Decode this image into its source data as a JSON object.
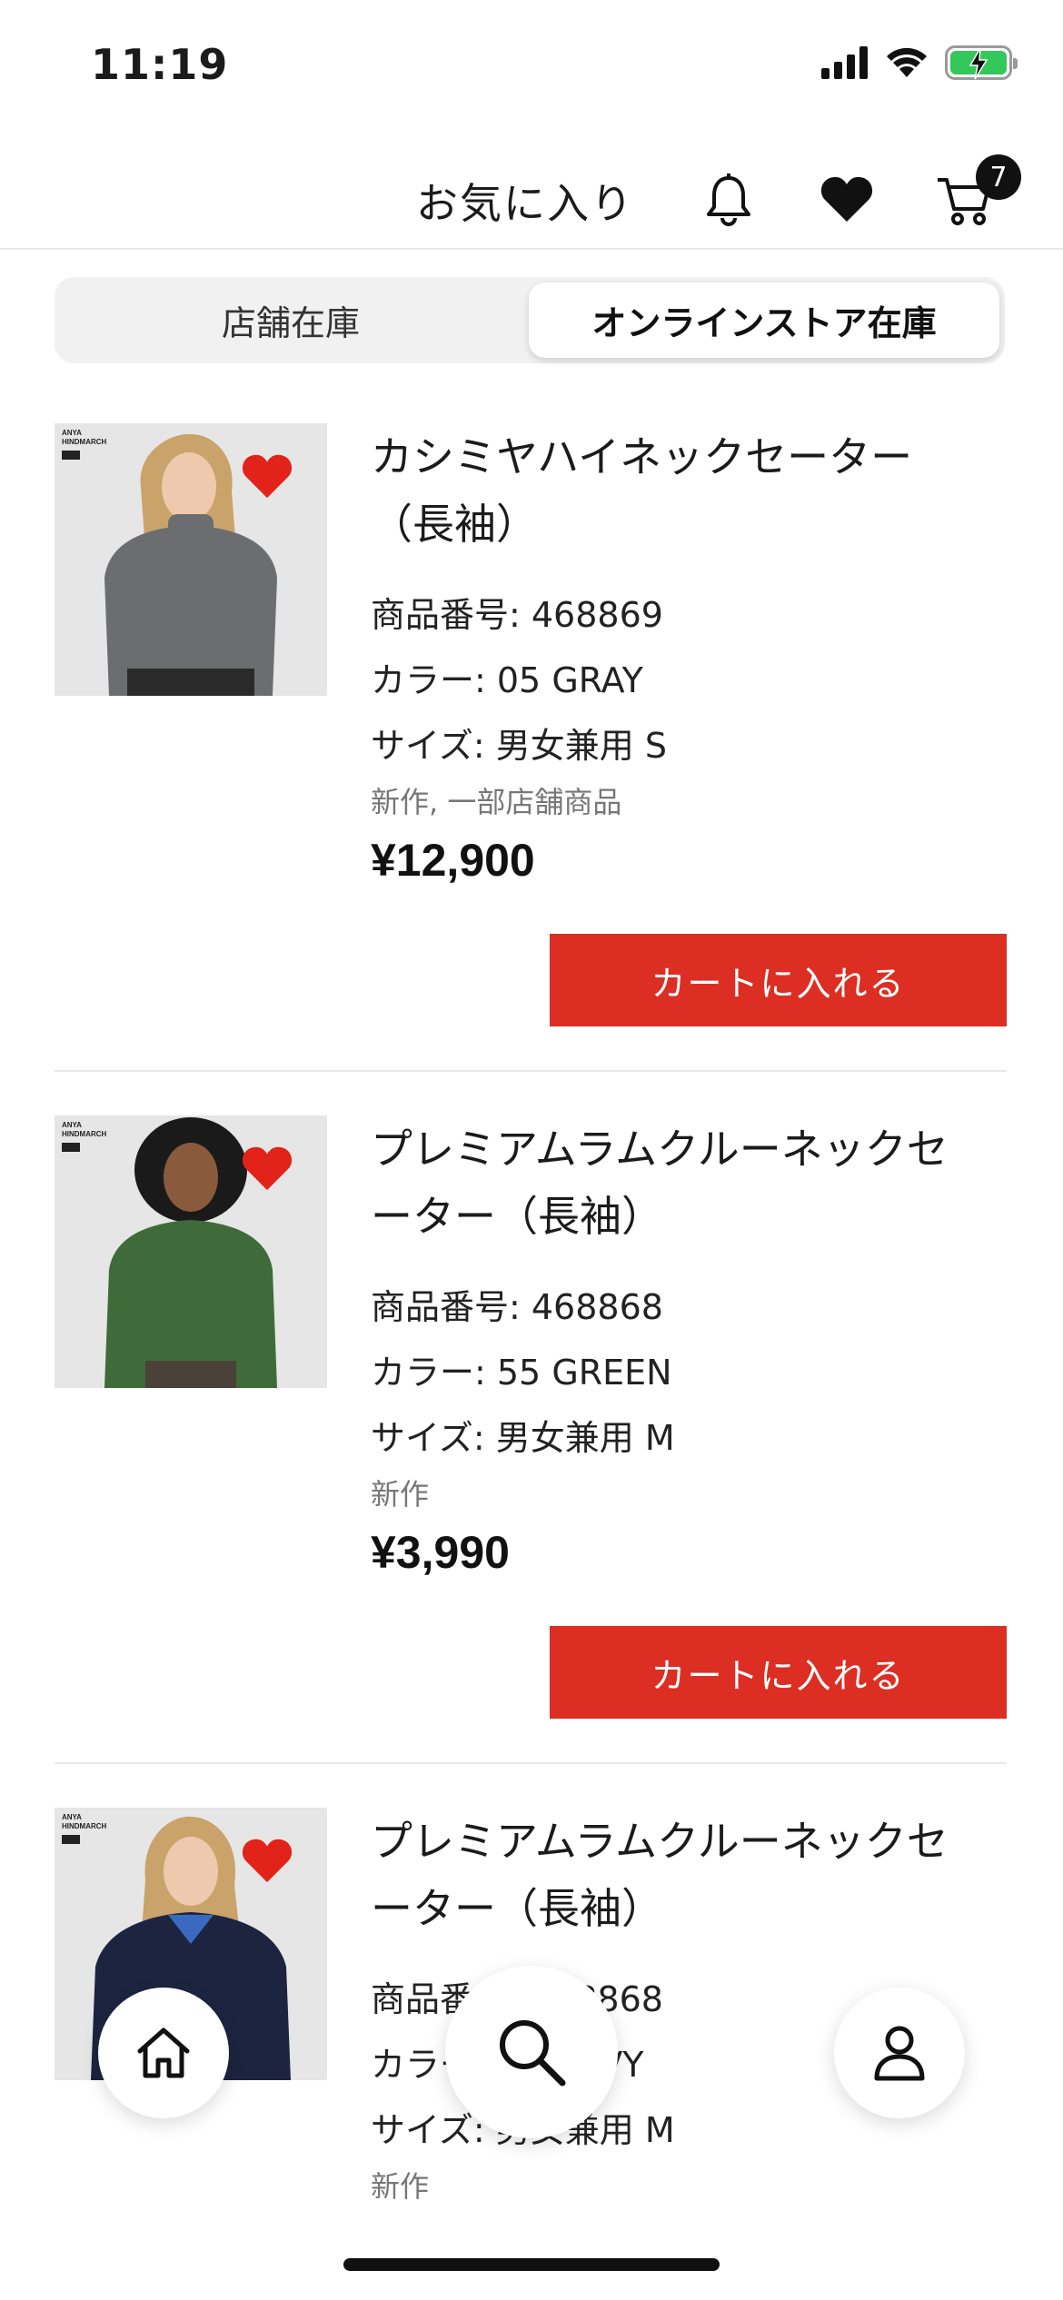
{
  "status_bar": {
    "time": "11:19"
  },
  "header": {
    "title": "お気に入り",
    "cart_count": "7"
  },
  "tabs": [
    {
      "label": "店舗在庫",
      "selected": false
    },
    {
      "label": "オンラインストア在庫",
      "selected": true
    }
  ],
  "products": [
    {
      "name_line1": "カシミヤハイネックセーター",
      "name_line2": "（長袖）",
      "number": "商品番号: 468869",
      "color": "カラー: 05 GRAY",
      "size": "サイズ: 男女兼用 S",
      "tags": "新作, 一部店舗商品",
      "price": "¥12,900",
      "add_to_cart": "カートに入れる",
      "brand": [
        "ANYA",
        "HINDMARCH"
      ],
      "sweater_color": "#6b6d70"
    },
    {
      "name_line1": "プレミアムラムクルーネックセ",
      "name_line2": "ーター（長袖）",
      "number": "商品番号: 468868",
      "color": "カラー: 55 GREEN",
      "size": "サイズ: 男女兼用 M",
      "tags": "新作",
      "price": "¥3,990",
      "add_to_cart": "カートに入れる",
      "brand": [
        "ANYA",
        "HINDMARCH"
      ],
      "sweater_color": "#3f6b3a"
    },
    {
      "name_line1": "プレミアムラムクルーネックセ",
      "name_line2": "ーター（長袖）",
      "number": "商品番号: 468868",
      "color": "カラー: 69 NAVY",
      "size": "サイズ: 男女兼用 M",
      "tags": "新作",
      "brand": [
        "ANYA",
        "HINDMARCH"
      ],
      "sweater_color": "#1c2440"
    }
  ],
  "colors": {
    "accent_red": "#dc2e22",
    "favorite_red": "#e2231a"
  },
  "nav": {
    "home": "home-icon",
    "search": "search-icon",
    "account": "account-icon"
  }
}
